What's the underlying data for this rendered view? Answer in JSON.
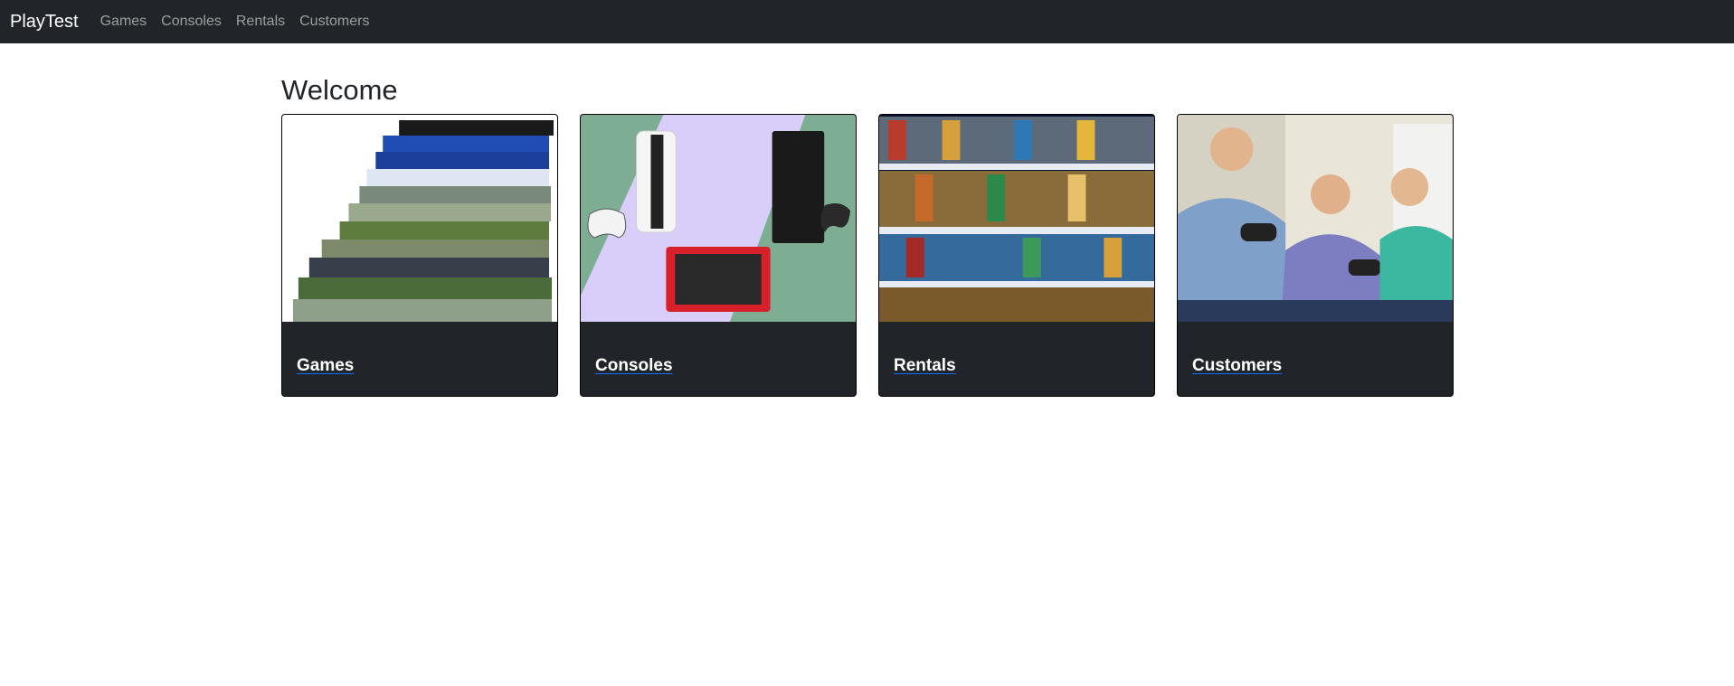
{
  "navbar": {
    "brand": "PlayTest",
    "links": [
      "Games",
      "Consoles",
      "Rentals",
      "Customers"
    ]
  },
  "main": {
    "title": "Welcome",
    "cards": [
      {
        "label": "Games",
        "image": "game-case-stack-image"
      },
      {
        "label": "Consoles",
        "image": "consoles-image"
      },
      {
        "label": "Rentals",
        "image": "game-shelf-image"
      },
      {
        "label": "Customers",
        "image": "gamers-playing-image"
      }
    ]
  },
  "colors": {
    "navbar_bg": "#212529",
    "card_footer_bg": "#212529",
    "link_underline": "#0d6efd",
    "text": "#212529"
  }
}
